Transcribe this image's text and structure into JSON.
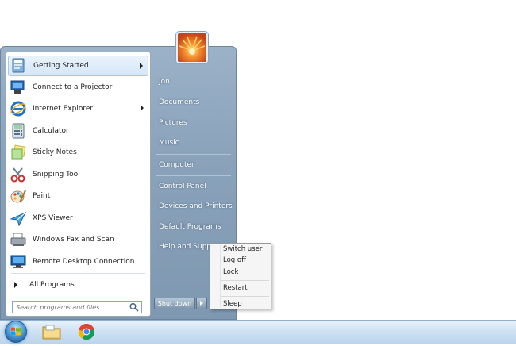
{
  "start_menu": {
    "programs": [
      {
        "label": "Getting Started",
        "icon": "getting-started-icon",
        "has_submenu": true
      },
      {
        "label": "Connect to a Projector",
        "icon": "projector-icon",
        "has_submenu": false
      },
      {
        "label": "Internet Explorer",
        "icon": "internet-explorer-icon",
        "has_submenu": true
      },
      {
        "label": "Calculator",
        "icon": "calculator-icon",
        "has_submenu": false
      },
      {
        "label": "Sticky Notes",
        "icon": "sticky-notes-icon",
        "has_submenu": false
      },
      {
        "label": "Snipping Tool",
        "icon": "snipping-tool-icon",
        "has_submenu": false
      },
      {
        "label": "Paint",
        "icon": "paint-icon",
        "has_submenu": false
      },
      {
        "label": "XPS Viewer",
        "icon": "xps-viewer-icon",
        "has_submenu": false
      },
      {
        "label": "Windows Fax and Scan",
        "icon": "fax-scan-icon",
        "has_submenu": false
      },
      {
        "label": "Remote Desktop Connection",
        "icon": "remote-desktop-icon",
        "has_submenu": false
      }
    ],
    "all_programs_label": "All Programs",
    "search_placeholder": "Search programs and files",
    "right_items": [
      "Jon",
      "Documents",
      "Pictures",
      "Music",
      "Computer",
      "Control Panel",
      "Devices and Printers",
      "Default Programs",
      "Help and Support"
    ],
    "shutdown_label": "Shut down"
  },
  "context_menu": {
    "items": [
      "Switch user",
      "Log off",
      "Lock",
      "Restart",
      "Sleep"
    ]
  },
  "taskbar": {
    "start_icon": "windows-start-orb-icon",
    "pinned": [
      "file-explorer-icon",
      "chrome-icon"
    ]
  },
  "colors": {
    "accent": "#7f98b1",
    "taskbar": "#cfe2f3",
    "highlight": "#d4e6f7"
  }
}
